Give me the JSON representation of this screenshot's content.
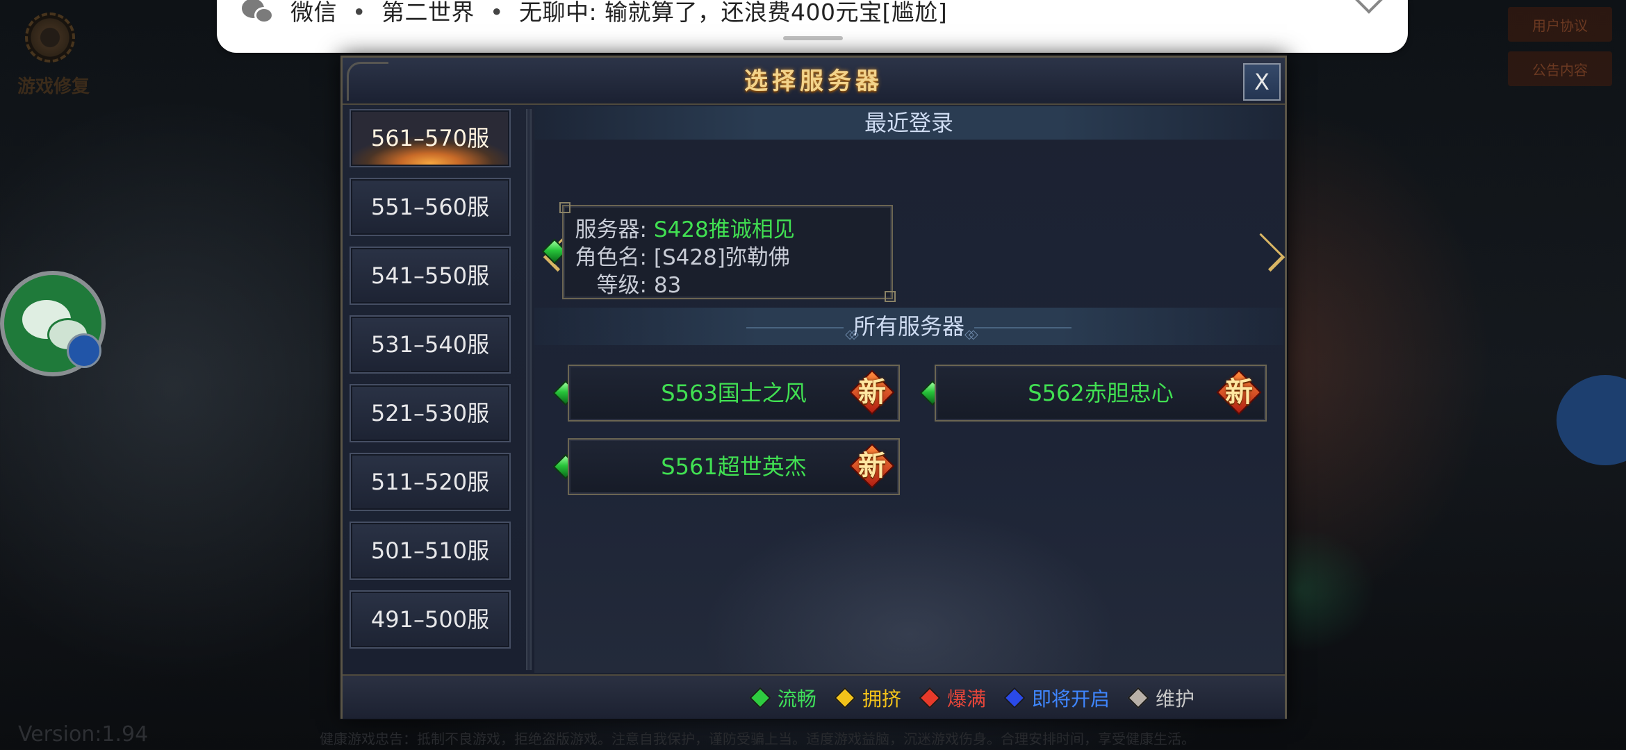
{
  "notification": {
    "app": "微信",
    "group": "第二世界",
    "message": "无聊中: 输就算了，还浪费400元宝[尴尬]"
  },
  "background": {
    "repair_label": "游戏修复",
    "version": "Version:1.94",
    "health_notice": "健康游戏忠告：抵制不良游戏，拒绝盗版游戏。注意自我保护，谨防受骗上当。适度游戏益脑，沉迷游戏伤身。合理安排时间，享受健康生活。",
    "top_right_1": "用户协议",
    "top_right_2": "公告内容"
  },
  "dialog": {
    "title": "选择服务器",
    "close_label": "X",
    "ranges": [
      "561–570服",
      "551–560服",
      "541–550服",
      "531–540服",
      "521–530服",
      "511–520服",
      "501–510服",
      "491–500服"
    ],
    "active_range_index": 0,
    "recent": {
      "header": "最近登录",
      "server_label": "服务器:",
      "server_value": "S428推诚相见",
      "role_label": "角色名:",
      "role_value": "[S428]弥勒佛",
      "level_label": "等级:",
      "level_value": "83"
    },
    "all": {
      "header": "所有服务器",
      "servers": [
        {
          "name": "S563国士之风",
          "badge": "新",
          "status": "流畅"
        },
        {
          "name": "S562赤胆忠心",
          "badge": "新",
          "status": "流畅"
        },
        {
          "name": "S561超世英杰",
          "badge": "新",
          "status": "流畅"
        }
      ]
    },
    "legend": [
      {
        "label": "流畅",
        "color": "#2ecc40",
        "text_color": "#3fe05a"
      },
      {
        "label": "拥挤",
        "color": "#f2c21a",
        "text_color": "#f2c21a"
      },
      {
        "label": "爆满",
        "color": "#e83a2a",
        "text_color": "#e8463a"
      },
      {
        "label": "即将开启",
        "color": "#2a4ae8",
        "text_color": "#3f86ff"
      },
      {
        "label": "维护",
        "color": "#b8b0a8",
        "text_color": "#c8c8c8"
      }
    ]
  }
}
